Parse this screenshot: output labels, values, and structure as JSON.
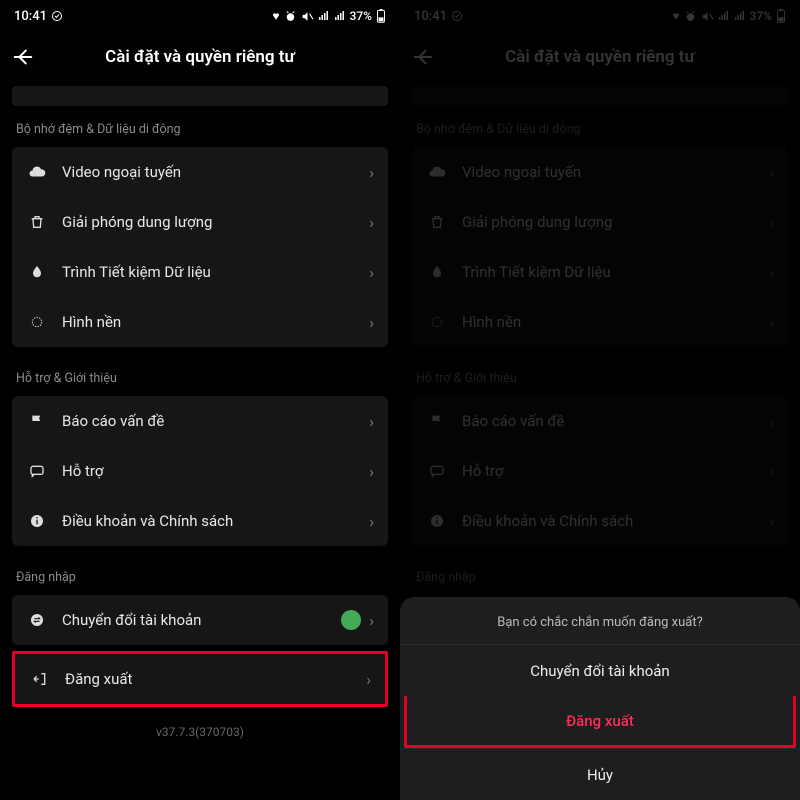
{
  "status": {
    "time": "10:41",
    "battery_text": "37%"
  },
  "header": {
    "title": "Cài đặt và quyền riêng tư"
  },
  "sections": {
    "cache": {
      "label": "Bộ nhớ đệm & Dữ liệu di động",
      "items": {
        "offline_video": "Video ngoại tuyến",
        "free_space": "Giải phóng dung lượng",
        "data_saver": "Trình Tiết kiệm Dữ liệu",
        "wallpaper": "Hình nền"
      }
    },
    "support": {
      "label": "Hỗ trợ & Giới thiệu",
      "items": {
        "report": "Báo cáo vấn đề",
        "help": "Hỗ trợ",
        "terms": "Điều khoản và Chính sách"
      }
    },
    "login": {
      "label": "Đăng nhập",
      "items": {
        "switch": "Chuyển đổi tài khoản",
        "logout": "Đăng xuất"
      }
    }
  },
  "version": "v37.7.3(370703)",
  "sheet": {
    "prompt": "Bạn có chắc chắn muốn đăng xuất?",
    "switch": "Chuyển đổi tài khoản",
    "logout": "Đăng xuất",
    "cancel": "Hủy"
  }
}
